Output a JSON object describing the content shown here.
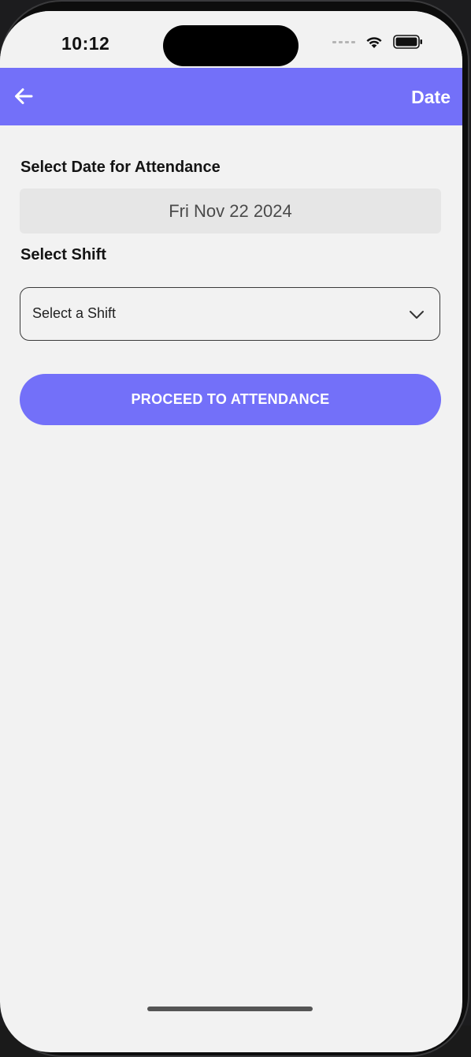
{
  "status_bar": {
    "time": "10:12",
    "icons": [
      "cellular-dots-icon",
      "wifi-icon",
      "battery-icon"
    ]
  },
  "app_bar": {
    "title": "Date",
    "back_icon": "arrow-left-icon",
    "color": "#7370f9"
  },
  "form": {
    "date_label": "Select Date for Attendance",
    "date_value": "Fri Nov 22 2024",
    "shift_label": "Select Shift",
    "shift_placeholder": "Select a Shift",
    "proceed_label": "PROCEED TO ATTENDANCE"
  },
  "colors": {
    "accent": "#7370f9",
    "background": "#f2f2f2",
    "date_field": "#e6e6e6"
  }
}
